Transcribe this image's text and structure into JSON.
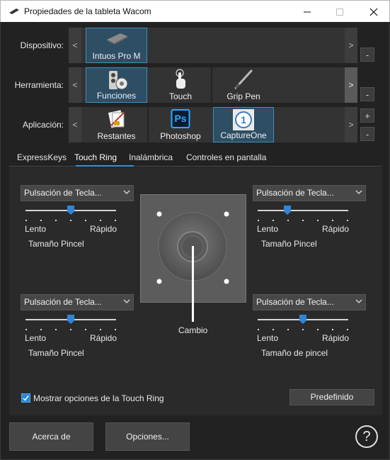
{
  "window": {
    "title": "Propiedades de la tableta Wacom"
  },
  "rows": {
    "device_label": "Dispositivo:",
    "tool_label": "Herramienta:",
    "app_label": "Aplicación:",
    "devices": [
      {
        "label": "Intuos Pro M",
        "icon": "tablet-icon",
        "selected": true
      }
    ],
    "tools": [
      {
        "label": "Funciones",
        "icon": "functions-icon",
        "selected": true
      },
      {
        "label": "Touch",
        "icon": "touch-hand-icon",
        "selected": false
      },
      {
        "label": "Grip Pen",
        "icon": "pen-icon",
        "selected": false
      }
    ],
    "apps": [
      {
        "label": "Restantes",
        "icon": "applications-icon",
        "selected": false
      },
      {
        "label": "Photoshop",
        "icon": "photoshop-icon",
        "icon_text": "Ps",
        "selected": false
      },
      {
        "label": "CaptureOne",
        "icon": "captureone-icon",
        "icon_text": "1",
        "selected": true
      }
    ],
    "nav_left": "<",
    "nav_right": ">",
    "side_minus": "-",
    "side_plus": "+"
  },
  "tabs": [
    "ExpressKeys",
    "Touch Ring",
    "Inalámbrica",
    "Controles en pantalla"
  ],
  "active_tab": "Touch Ring",
  "touch_ring": {
    "top_left": {
      "function": "Pulsación de Tecla...",
      "slow": "Lento",
      "fast": "Rápido",
      "slider_value": 0.5,
      "caption": "Tamaño Pincel"
    },
    "top_right": {
      "function": "Pulsación de Tecla...",
      "slow": "Lento",
      "fast": "Rápido",
      "slider_value": 0.33,
      "caption": "Tamaño Pincel"
    },
    "bottom_left": {
      "function": "Pulsación de Tecla...",
      "slow": "Lento",
      "fast": "Rápido",
      "slider_value": 0.5,
      "caption": "Tamaño Pincel"
    },
    "bottom_right": {
      "function": "Pulsación de Tecla...",
      "slow": "Lento",
      "fast": "Rápido",
      "slider_value": 0.5,
      "caption": "Tamaño de pincel"
    },
    "center_label": "Cambio",
    "show_options_label": "Mostrar opciones de la Touch Ring",
    "show_options_checked": true,
    "default_button": "Predefinido"
  },
  "footer": {
    "about_button": "Acerca de",
    "options_button": "Opciones...",
    "help_icon": "?"
  },
  "colors": {
    "accent": "#2f86d6",
    "selected_tile": "#2d4e63",
    "background": "#222222"
  }
}
